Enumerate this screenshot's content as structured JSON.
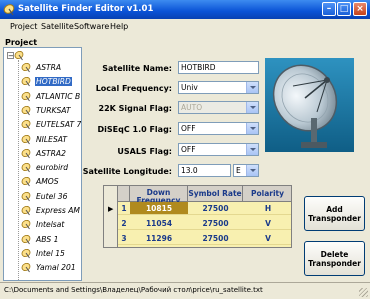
{
  "window": {
    "title": "Satellite Finder Editor  v1.01"
  },
  "menu": [
    "Project",
    "Satellite",
    "Software",
    "Help"
  ],
  "project": {
    "label": "Project",
    "satellites": [
      "ASTRA",
      "HOTBIRD",
      "ATLANTIC B",
      "TURKSAT",
      "EUTELSAT 7",
      "NILESAT",
      "ASTRA2",
      "eurobird",
      "AMOS",
      "Eutel 36",
      "Express AM",
      "Intelsat",
      "ABS 1",
      "Intel 15",
      "Yamal 201"
    ],
    "selected_index": 1
  },
  "form": {
    "satellite_name_label": "Satellite Name:",
    "satellite_name_value": "HOTBIRD",
    "local_frequency_label": "Local Frequency:",
    "local_frequency_value": "Univ",
    "signal_flag_label": "22K Signal Flag:",
    "signal_flag_value": "AUTO",
    "diseqc_label": "DiSEqC 1.0 Flag:",
    "diseqc_value": "OFF",
    "usals_label": "USALS Flag:",
    "usals_value": "OFF",
    "longitude_label": "Satellite Longitude:",
    "longitude_value": "13.0",
    "longitude_direction": "E"
  },
  "transponders": {
    "columns": [
      "Down Frequency",
      "Symbol Rate",
      "Polarity"
    ],
    "rows": [
      {
        "index": "1",
        "frequency": "10815",
        "symbol_rate": "27500",
        "polarity": "H"
      },
      {
        "index": "2",
        "frequency": "11054",
        "symbol_rate": "27500",
        "polarity": "V"
      },
      {
        "index": "3",
        "frequency": "11296",
        "symbol_rate": "27500",
        "polarity": "V"
      }
    ]
  },
  "buttons": {
    "add": "Add\nTransponder",
    "delete": "Delete\nTransponder"
  },
  "status": {
    "path": "C:\\Documents and Settings\\Владелец\\Рабочий стол\\price\\ru_satellite.txt"
  },
  "icons": {
    "app": "satellite-dish-icon",
    "tree_item": "satellite-dish-icon",
    "main_image": "satellite-dish-image"
  }
}
